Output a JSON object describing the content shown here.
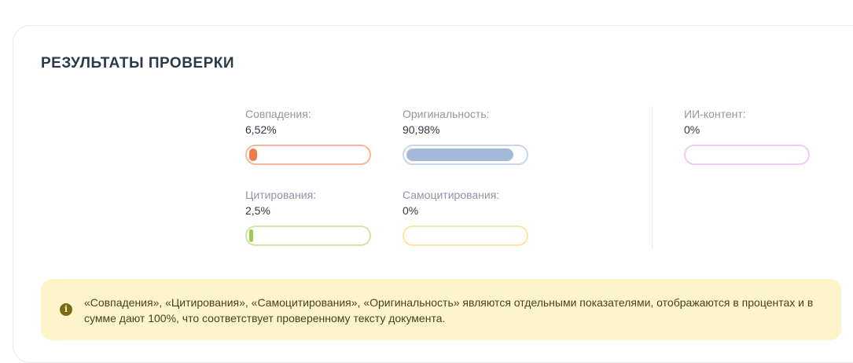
{
  "results": {
    "title": "РЕЗУЛЬТАТЫ ПРОВЕРКИ",
    "metrics": {
      "matches": {
        "label": "Совпадения:",
        "value": "6,52%",
        "percent": 6.52,
        "border_color": "#f6b899",
        "fill_color": "#f07a45"
      },
      "originality": {
        "label": "Оригинальность:",
        "value": "90,98%",
        "percent": 90.98,
        "border_color": "#c9d5e8",
        "fill_color": "#a4badb"
      },
      "citations": {
        "label": "Цитирования:",
        "value": "2,5%",
        "percent": 2.5,
        "border_color": "#d3e4a7",
        "fill_color": "#9ccc52"
      },
      "self_citations": {
        "label": "Самоцитирования:",
        "value": "0%",
        "percent": 0,
        "border_color": "#fbe6a4",
        "fill_color": "#f5cf55"
      },
      "ai_content": {
        "label": "ИИ-контент:",
        "value": "0%",
        "percent": 0,
        "border_color": "#f0cdf0",
        "fill_color": "#d892d8"
      }
    },
    "notice": {
      "icon": "info-icon",
      "text": "«Совпадения», «Цитирования», «Самоцитирования», «Оригинальность» являются отдельными показателями, отображаются в процентах и в сумме дают 100%, что соответствует проверенному тексту документа."
    }
  }
}
